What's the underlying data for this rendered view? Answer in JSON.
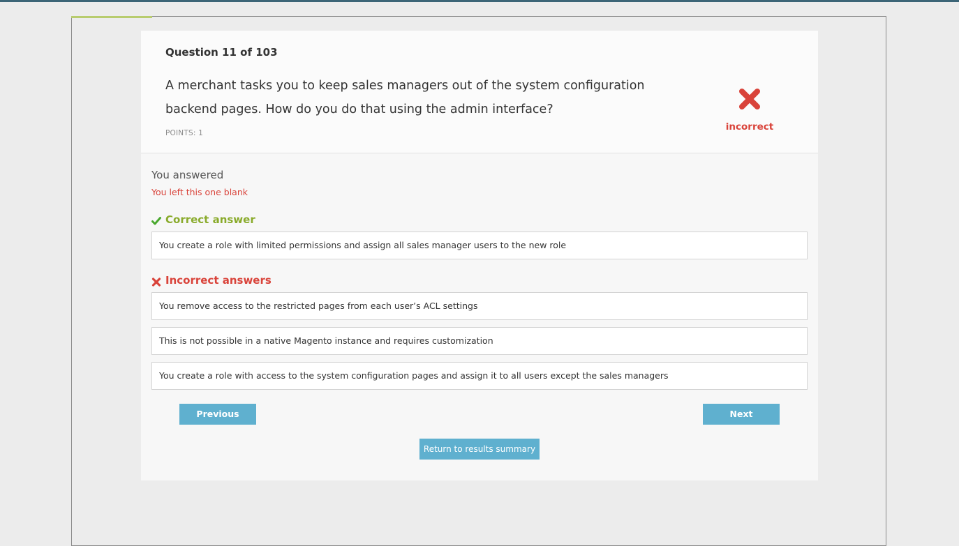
{
  "question": {
    "number_label": "Question 11 of 103",
    "text": "A merchant tasks you to keep sales managers out of the system configuration backend pages. How do you do that using the admin interface?",
    "points_label": "POINTS: 1",
    "status": "incorrect"
  },
  "answered": {
    "label": "You answered",
    "note": "You left this one blank"
  },
  "correct": {
    "heading": "Correct answer",
    "answers": [
      "You create a role with limited permissions and assign all sales manager users to the new role"
    ]
  },
  "incorrect": {
    "heading": "Incorrect answers",
    "answers": [
      "You remove access to the restricted pages from each user’s ACL settings",
      "This is not possible in a native Magento instance and requires customization",
      "You create a role with access to the system configuration pages and assign it to all users except the sales managers"
    ]
  },
  "nav": {
    "previous": "Previous",
    "next": "Next",
    "return": "Return to results summary"
  },
  "icons": {
    "status": "x-mark-icon",
    "correct": "checkmark-icon",
    "incorrect": "x-mark-icon"
  },
  "colors": {
    "accent": "#5fb0cf",
    "correct": "#8aab2c",
    "incorrect": "#d9433a"
  }
}
